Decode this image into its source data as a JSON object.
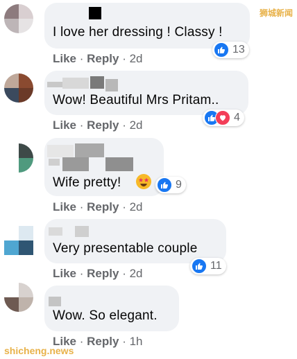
{
  "watermarks": {
    "top_right": "狮城新闻",
    "bottom_left": "shicheng.news"
  },
  "colors": {
    "bubble": "#f0f2f5",
    "like_blue": "#1877f2",
    "love_red": "#f33e58",
    "meta_gray": "#65676b"
  },
  "comments": [
    {
      "text": "I love her dressing ! Classy !",
      "reactions": [
        "like-icon"
      ],
      "count": "13",
      "actions": {
        "like": "Like",
        "reply": "Reply",
        "sep": "·",
        "time": "2d"
      }
    },
    {
      "text": "Wow! Beautiful Mrs Pritam..",
      "reactions": [
        "like-icon",
        "love-icon"
      ],
      "count": "4",
      "actions": {
        "like": "Like",
        "reply": "Reply",
        "sep": "·",
        "time": "2d"
      }
    },
    {
      "text": "Wife pretty!",
      "emoji": "star-struck-emoji",
      "reactions": [
        "like-icon"
      ],
      "count": "9",
      "actions": {
        "like": "Like",
        "reply": "Reply",
        "sep": "·",
        "time": "2d"
      }
    },
    {
      "text": "Very presentable couple",
      "reactions": [
        "like-icon"
      ],
      "count": "11",
      "actions": {
        "like": "Like",
        "reply": "Reply",
        "sep": "·",
        "time": "2d"
      }
    },
    {
      "text": "Wow. So elegant.",
      "reactions": [],
      "count": "",
      "actions": {
        "like": "Like",
        "reply": "Reply",
        "sep": "·",
        "time": "1h"
      }
    }
  ]
}
